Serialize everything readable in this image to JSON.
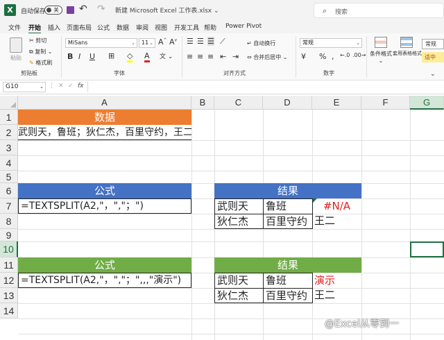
{
  "titlebar": {
    "autosave_label": "自动保存",
    "autosave_state": "关",
    "doc_title": "新建 Microsoft Excel 工作表.xlsx",
    "search_placeholder": "搜索"
  },
  "menu": {
    "tabs": [
      "文件",
      "开始",
      "插入",
      "页面布局",
      "公式",
      "数据",
      "审阅",
      "视图",
      "开发工具",
      "帮助",
      "Power Pivot"
    ],
    "active_tab": "开始"
  },
  "ribbon": {
    "clipboard": {
      "paste": "粘贴",
      "cut": "剪切",
      "copy": "复制",
      "format_painter": "格式刷",
      "label": "剪贴板"
    },
    "font": {
      "name": "MiSans",
      "size": "11",
      "label": "字体",
      "bold": "B",
      "italic": "I",
      "underline": "U"
    },
    "alignment": {
      "wrap": "自动换行",
      "merge": "合并后居中",
      "label": "对齐方式"
    },
    "number": {
      "format": "常规",
      "label": "数字"
    },
    "styles": {
      "conditional": "条件格式",
      "table": "套用表格格式",
      "normal": "常规",
      "neutral": "适中"
    }
  },
  "formula_bar": {
    "name_box": "G10",
    "fx": "fx",
    "content": ""
  },
  "sheet": {
    "columns": [
      "A",
      "B",
      "C",
      "D",
      "E",
      "F",
      "G"
    ],
    "rows": [
      "1",
      "2",
      "3",
      "4",
      "5",
      "6",
      "7",
      "8",
      "9",
      "10",
      "11",
      "12",
      "13",
      "14"
    ],
    "selected_column": "G",
    "selected_row": "10",
    "data_header": "数据",
    "data_value": "武则天，鲁班；狄仁杰，百里守约，王二",
    "formula_header_1": "公式",
    "formula_1": "=TEXTSPLIT(A2,\"，\",\"；\")",
    "result_header_1": "结果",
    "result_1": [
      [
        "武则天",
        "鲁班",
        "#N/A"
      ],
      [
        "狄仁杰",
        "百里守约",
        "王二"
      ]
    ],
    "formula_header_2": "公式",
    "formula_2": "=TEXTSPLIT(A2,\"，\",\"；\",,,\"演示\")",
    "result_header_2": "结果",
    "result_2": [
      [
        "武则天",
        "鲁班",
        "演示"
      ],
      [
        "狄仁杰",
        "百里守约",
        "王二"
      ]
    ]
  },
  "colors": {
    "excel_green": "#1d6f42",
    "orange_header": "#ed7d31",
    "blue_header": "#4472c4",
    "green_header": "#70ad47",
    "error_red": "#e02020"
  },
  "watermark": "@Excel从零到一"
}
